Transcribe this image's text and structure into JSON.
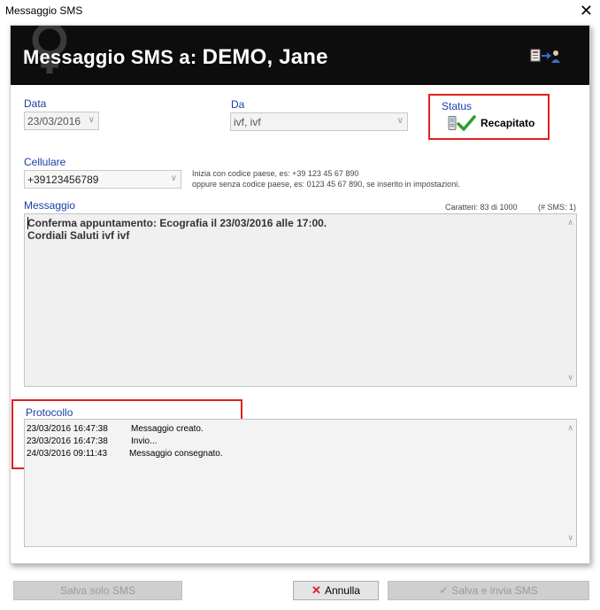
{
  "window": {
    "title": "Messaggio SMS",
    "close_label": "✕"
  },
  "header": {
    "title_prefix": "Messaggio SMS a:",
    "recipient": "DEMO, Jane",
    "icon": "contact-transfer-icon"
  },
  "form": {
    "data": {
      "label": "Data",
      "value": "23/03/2016"
    },
    "da": {
      "label": "Da",
      "value": "ivf, ivf"
    },
    "status": {
      "label": "Status",
      "value": "Recapitato",
      "icon": "check-icon",
      "color": "#2e9b2e"
    },
    "cellulare": {
      "label": "Cellulare",
      "value": "+39123456789"
    },
    "hint_line1": "Inizia con codice paese, es: +39 123 45 67 890",
    "hint_line2": "oppure senza codice paese, es: 0123 45 67 890, se inserito in impostazioni.",
    "messaggio": {
      "label": "Messaggio",
      "chars": "Caratteri: 83 di 1000",
      "sms_count": "(# SMS: 1)",
      "text": "Conferma appuntamento: Ecografia il 23/03/2016 alle 17:00.\nCordiali Saluti ivf ivf"
    },
    "protocollo": {
      "label": "Protocollo",
      "rows": [
        {
          "time": "23/03/2016 16:47:38",
          "event": "Messaggio creato."
        },
        {
          "time": "23/03/2016 16:47:38",
          "event": "Invio..."
        },
        {
          "time": "24/03/2016 09:11:43",
          "event": "Messaggio consegnato."
        }
      ]
    }
  },
  "buttons": {
    "save_only": "Salva solo SMS",
    "cancel": "Annulla",
    "save_send": "Salva e invia SMS"
  },
  "colors": {
    "highlight": "#e0201f",
    "label_blue": "#1a3fa8",
    "header_bg": "#0d0d0d"
  }
}
